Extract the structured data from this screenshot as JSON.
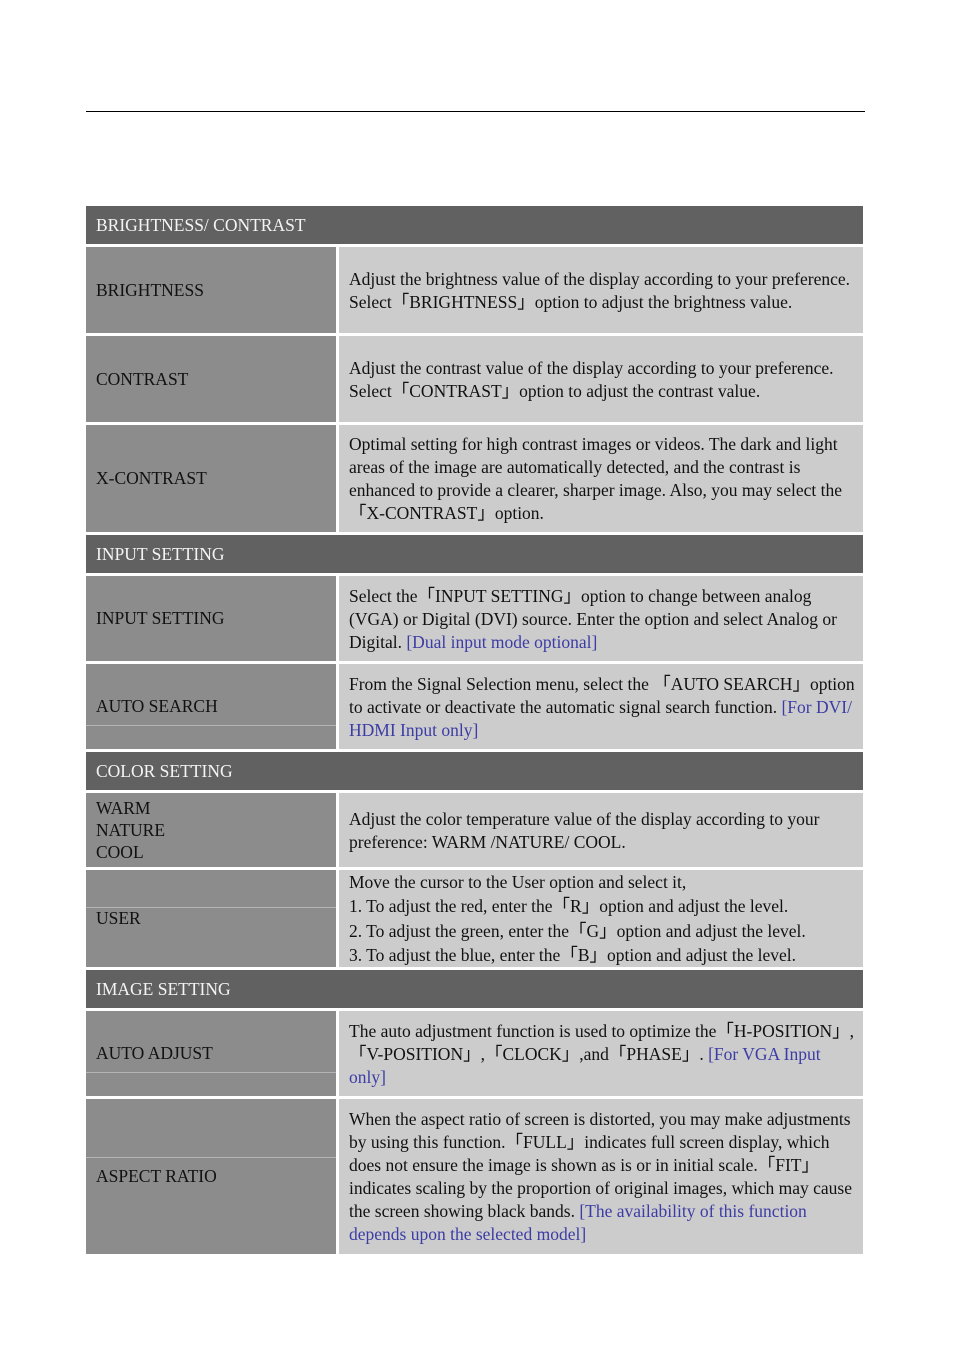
{
  "sections": [
    {
      "title": "BRIGHTNESS/ CONTRAST",
      "rows": [
        {
          "label": "BRIGHTNESS",
          "desc": "Adjust the brightness value of the display according to your preference. Select「BRIGHTNESS」option to adjust the brightness value.",
          "note": ""
        },
        {
          "label": "CONTRAST",
          "desc": "Adjust the contrast value of the display according to your preference. Select「CONTRAST」option to adjust the contrast value.",
          "note": ""
        },
        {
          "label": "X-CONTRAST",
          "desc": "Optimal setting for high contrast images or videos. The dark and light areas of the image are automatically detected, and the contrast is enhanced to provide a clearer, sharper image. Also, you may select the「X-CONTRAST」option.",
          "note": ""
        }
      ]
    },
    {
      "title": "INPUT SETTING",
      "rows": [
        {
          "label": "INPUT SETTING",
          "desc": "Select the「INPUT SETTING」option to change between analog (VGA) or Digital (DVI) source. Enter the option and select Analog or Digital. ",
          "note": "[Dual input mode optional]"
        },
        {
          "label": "AUTO SEARCH",
          "desc": "From the Signal Selection menu, select the 「AUTO SEARCH」option to activate or deactivate the automatic signal search function. ",
          "note": "[For DVI/ HDMI Input only]"
        }
      ]
    },
    {
      "title": "COLOR SETTING",
      "rows": [
        {
          "label_lines": [
            "WARM",
            "NATURE",
            "COOL"
          ],
          "desc": "Adjust the color temperature value of the display according to your preference: WARM /NATURE/ COOL.",
          "note": ""
        },
        {
          "label": "USER",
          "desc_lines": [
            "Move the cursor to the User option and select it,",
            "1. To adjust the red, enter the「R」option and adjust the level.",
            "2. To adjust the green, enter the「G」option and adjust the level.",
            "3. To adjust the blue, enter the「B」option and adjust the level."
          ]
        }
      ]
    },
    {
      "title": "IMAGE SETTING",
      "rows": [
        {
          "label": "AUTO ADJUST",
          "desc": "The auto adjustment function is used to optimize the「H-POSITION」,「V-POSITION」,「CLOCK」,and「PHASE」. ",
          "note": "[For VGA Input only]"
        },
        {
          "label": "ASPECT RATIO",
          "desc": "When the aspect ratio of screen is distorted, you may make adjustments by using this function.「FULL」indicates full screen display, which does not ensure the image is shown as is or in initial scale.「FIT」indicates scaling by the proportion of original images, which may cause the screen showing black bands. ",
          "note": "[The availability of this function depends upon the selected model]"
        }
      ]
    }
  ],
  "colors": {
    "section_header_bg": "#616161",
    "label_cell_bg": "#8c8c8c",
    "desc_cell_bg": "#cccccc",
    "note_text": "#3c3ca6"
  }
}
